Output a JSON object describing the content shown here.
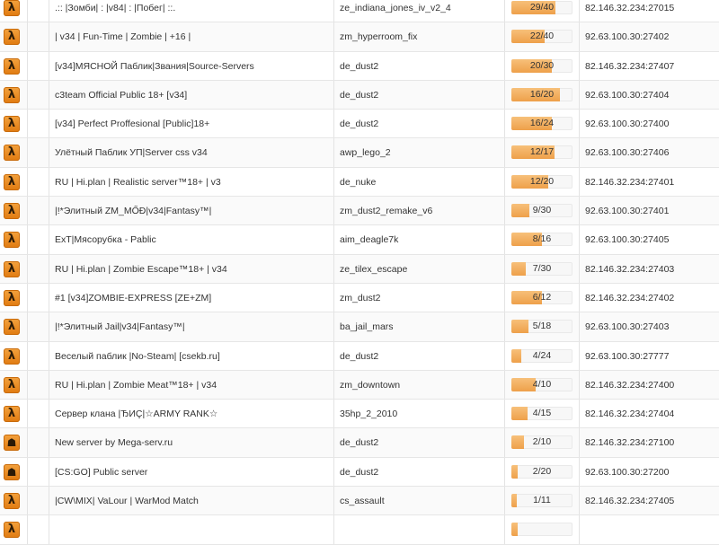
{
  "servers": [
    {
      "icon": "hl-icon",
      "name": ".:: |Зомби| : |v84| : |Побег| ::.",
      "map": "ze_indiana_jones_iv_v2_4",
      "players": "29/40",
      "fill": 0.725,
      "ip": "82.146.32.234:27015"
    },
    {
      "icon": "hl-icon",
      "name": "| v34 | Fun-Time | Zombie | +16 |",
      "map": "zm_hyperroom_fix",
      "players": "22/40",
      "fill": 0.55,
      "ip": "92.63.100.30:27402"
    },
    {
      "icon": "hl-icon",
      "name": "[v34]МЯСНОЙ Паблик|Звания|Source-Servers",
      "map": "de_dust2",
      "players": "20/30",
      "fill": 0.667,
      "ip": "82.146.32.234:27407"
    },
    {
      "icon": "hl-icon",
      "name": "c3team Official Public 18+ [v34]",
      "map": "de_dust2",
      "players": "16/20",
      "fill": 0.8,
      "ip": "92.63.100.30:27404"
    },
    {
      "icon": "hl-icon",
      "name": "[v34] Perfect Proffesional [Public]18+",
      "map": "de_dust2",
      "players": "16/24",
      "fill": 0.667,
      "ip": "92.63.100.30:27400"
    },
    {
      "icon": "hl-icon",
      "name": "Улётный Паблик УП|Server css v34",
      "map": "awp_lego_2",
      "players": "12/17",
      "fill": 0.706,
      "ip": "92.63.100.30:27406"
    },
    {
      "icon": "hl-icon",
      "name": "RU | Hi.plan | Realistic server™18+ | v3",
      "map": "de_nuke",
      "players": "12/20",
      "fill": 0.6,
      "ip": "82.146.32.234:27401"
    },
    {
      "icon": "hl-icon",
      "name": "|!*Элитный ZM_MŐĐ|v34|Fantasy™|",
      "map": "zm_dust2_remake_v6",
      "players": "9/30",
      "fill": 0.3,
      "ip": "92.63.100.30:27401"
    },
    {
      "icon": "hl-icon",
      "name": "ExT|Мясорубка - Pablic",
      "map": "aim_deagle7k",
      "players": "8/16",
      "fill": 0.5,
      "ip": "92.63.100.30:27405"
    },
    {
      "icon": "hl-icon",
      "name": "RU | Hi.plan | Zombie Escape™18+ | v34",
      "map": "ze_tilex_escape",
      "players": "7/30",
      "fill": 0.233,
      "ip": "82.146.32.234:27403"
    },
    {
      "icon": "hl-icon",
      "name": "#1 [v34]ZOMBIE-EXPRESS [ZE+ZM]",
      "map": "zm_dust2",
      "players": "6/12",
      "fill": 0.5,
      "ip": "82.146.32.234:27402"
    },
    {
      "icon": "hl-icon",
      "name": "|!*Элитный Jail|v34|Fantasy™|",
      "map": "ba_jail_mars",
      "players": "5/18",
      "fill": 0.278,
      "ip": "92.63.100.30:27403"
    },
    {
      "icon": "hl-icon",
      "name": "Веселый паблик |No-Steam| [csekb.ru]",
      "map": "de_dust2",
      "players": "4/24",
      "fill": 0.167,
      "ip": "92.63.100.30:27777"
    },
    {
      "icon": "hl-icon",
      "name": "RU | Hi.plan | Zombie Meat™18+ | v34",
      "map": "zm_downtown",
      "players": "4/10",
      "fill": 0.4,
      "ip": "82.146.32.234:27400"
    },
    {
      "icon": "hl-icon",
      "name": "Сервер клана |ЂИÇ|☆ARMY RANK☆",
      "map": "35hp_2_2010",
      "players": "4/15",
      "fill": 0.267,
      "ip": "82.146.32.234:27404"
    },
    {
      "icon": "cs-icon",
      "name": "New server by Mega-serv.ru",
      "map": "de_dust2",
      "players": "2/10",
      "fill": 0.2,
      "ip": "82.146.32.234:27100"
    },
    {
      "icon": "cs-icon",
      "name": "[CS:GO] Public server",
      "map": "de_dust2",
      "players": "2/20",
      "fill": 0.1,
      "ip": "92.63.100.30:27200"
    },
    {
      "icon": "hl-icon",
      "name": "|CW\\MIX| VaLour | WarMod Match",
      "map": "cs_assault",
      "players": "1/11",
      "fill": 0.091,
      "ip": "82.146.32.234:27405"
    },
    {
      "icon": "hl-icon",
      "name": "",
      "map": "",
      "players": "",
      "fill": 0.1,
      "ip": ""
    }
  ]
}
